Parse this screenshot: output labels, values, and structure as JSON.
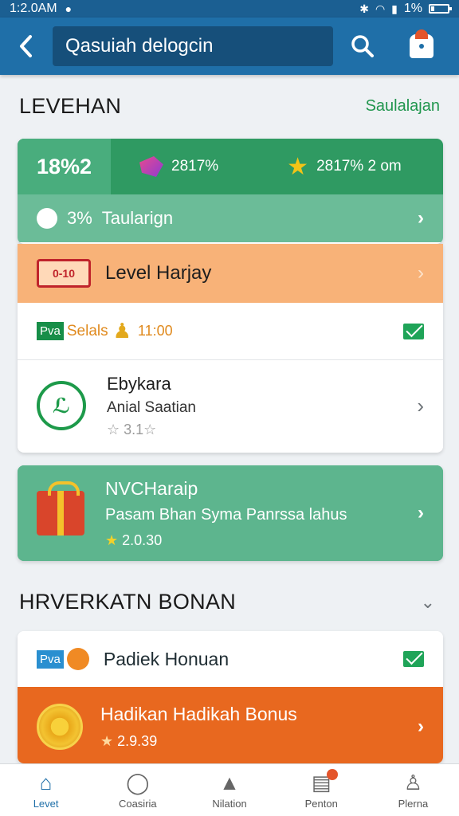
{
  "status_bar": {
    "time": "1:2.0AM",
    "battery": "1%"
  },
  "app_bar": {
    "search_text": "Qasuiah delogcin"
  },
  "section1": {
    "title": "LEVEHAN",
    "link": "Saulalajan"
  },
  "stats": {
    "big": "18%2",
    "gem_value": "2817%",
    "star_value": "2817% 2 om"
  },
  "taul": {
    "percent": "3%",
    "label": "Taularign"
  },
  "level": {
    "badge": "0-10",
    "label": "Level Harjay"
  },
  "tag_row": {
    "tag": "Pva",
    "text": "Selals",
    "time": "11:00"
  },
  "app_item": {
    "name": "Ebykara",
    "sub": "Anial Saatian",
    "rating": "☆ 3.1☆"
  },
  "teal_card": {
    "title": "NVCHaraip",
    "sub": "Pasam Bhan Syma Panrssa lahus",
    "rating": "2.0.30"
  },
  "section2": {
    "title": "HRVERKATN BONAN"
  },
  "bonus_row": {
    "tag": "Pva",
    "label": "Padiek Honuan"
  },
  "orange_card": {
    "title": "Hadikan Hadikah Bonus",
    "rating": "2.9.39"
  },
  "bottom_nav": [
    {
      "label": "Levet"
    },
    {
      "label": "Coasiria"
    },
    {
      "label": "Nilation"
    },
    {
      "label": "Penton"
    },
    {
      "label": "Plerna"
    }
  ],
  "colors": {
    "primary": "#1f6fa8",
    "green": "#2f9a62",
    "orange": "#e8681f",
    "peach": "#f8b278",
    "teal": "#5db58e"
  }
}
